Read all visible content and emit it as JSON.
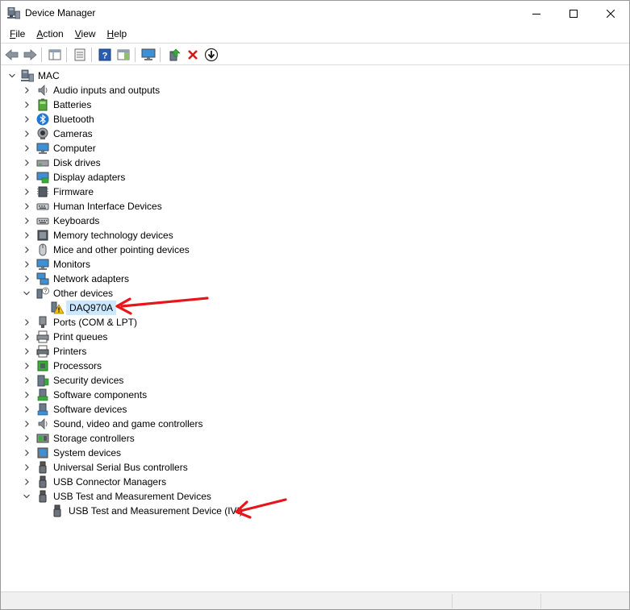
{
  "window": {
    "title": "Device Manager"
  },
  "menu": [
    {
      "label": "File",
      "accel": "F",
      "rest": "ile"
    },
    {
      "label": "Action",
      "accel": "A",
      "rest": "ction"
    },
    {
      "label": "View",
      "accel": "V",
      "rest": "iew"
    },
    {
      "label": "Help",
      "accel": "H",
      "rest": "elp"
    }
  ],
  "toolbar": {
    "buttons": [
      "back-icon",
      "forward-icon",
      "show-hide-console-tree-icon",
      "properties-icon",
      "help-icon",
      "action-pane-icon",
      "monitor-icon",
      "update-driver-icon",
      "uninstall-icon",
      "download-icon"
    ]
  },
  "tree": {
    "root": "MAC",
    "categories": [
      {
        "label": "Audio inputs and outputs",
        "icon": "speaker-icon",
        "expanded": false
      },
      {
        "label": "Batteries",
        "icon": "battery-icon",
        "expanded": false
      },
      {
        "label": "Bluetooth",
        "icon": "bluetooth-icon",
        "expanded": false
      },
      {
        "label": "Cameras",
        "icon": "camera-icon",
        "expanded": false
      },
      {
        "label": "Computer",
        "icon": "computer-icon",
        "expanded": false
      },
      {
        "label": "Disk drives",
        "icon": "disk-drive-icon",
        "expanded": false
      },
      {
        "label": "Display adapters",
        "icon": "display-adapter-icon",
        "expanded": false
      },
      {
        "label": "Firmware",
        "icon": "firmware-icon",
        "expanded": false
      },
      {
        "label": "Human Interface Devices",
        "icon": "hid-icon",
        "expanded": false
      },
      {
        "label": "Keyboards",
        "icon": "keyboard-icon",
        "expanded": false
      },
      {
        "label": "Memory technology devices",
        "icon": "memory-icon",
        "expanded": false
      },
      {
        "label": "Mice and other pointing devices",
        "icon": "mouse-icon",
        "expanded": false
      },
      {
        "label": "Monitors",
        "icon": "monitor-icon",
        "expanded": false
      },
      {
        "label": "Network adapters",
        "icon": "network-icon",
        "expanded": false
      },
      {
        "label": "Other devices",
        "icon": "unknown-device-icon",
        "expanded": true,
        "children": [
          {
            "label": "DAQ970A",
            "icon": "warning-device-icon",
            "selected": true
          }
        ]
      },
      {
        "label": "Ports (COM & LPT)",
        "icon": "port-icon",
        "expanded": false
      },
      {
        "label": "Print queues",
        "icon": "print-queue-icon",
        "expanded": false
      },
      {
        "label": "Printers",
        "icon": "printer-icon",
        "expanded": false
      },
      {
        "label": "Processors",
        "icon": "processor-icon",
        "expanded": false
      },
      {
        "label": "Security devices",
        "icon": "security-icon",
        "expanded": false
      },
      {
        "label": "Software components",
        "icon": "software-component-icon",
        "expanded": false
      },
      {
        "label": "Software devices",
        "icon": "software-device-icon",
        "expanded": false
      },
      {
        "label": "Sound, video and game controllers",
        "icon": "sound-icon",
        "expanded": false
      },
      {
        "label": "Storage controllers",
        "icon": "storage-icon",
        "expanded": false
      },
      {
        "label": "System devices",
        "icon": "system-icon",
        "expanded": false
      },
      {
        "label": "Universal Serial Bus controllers",
        "icon": "usb-icon",
        "expanded": false
      },
      {
        "label": "USB Connector Managers",
        "icon": "usb-icon",
        "expanded": false
      },
      {
        "label": "USB Test and Measurement Devices",
        "icon": "usb-icon",
        "expanded": true,
        "children": [
          {
            "label": "USB Test and Measurement Device (IVI)",
            "icon": "usb-icon",
            "selected": false
          }
        ]
      }
    ]
  },
  "colors": {
    "selection": "#cce8ff",
    "annotation_arrow": "#e8141b",
    "warning": "#f5c400"
  }
}
